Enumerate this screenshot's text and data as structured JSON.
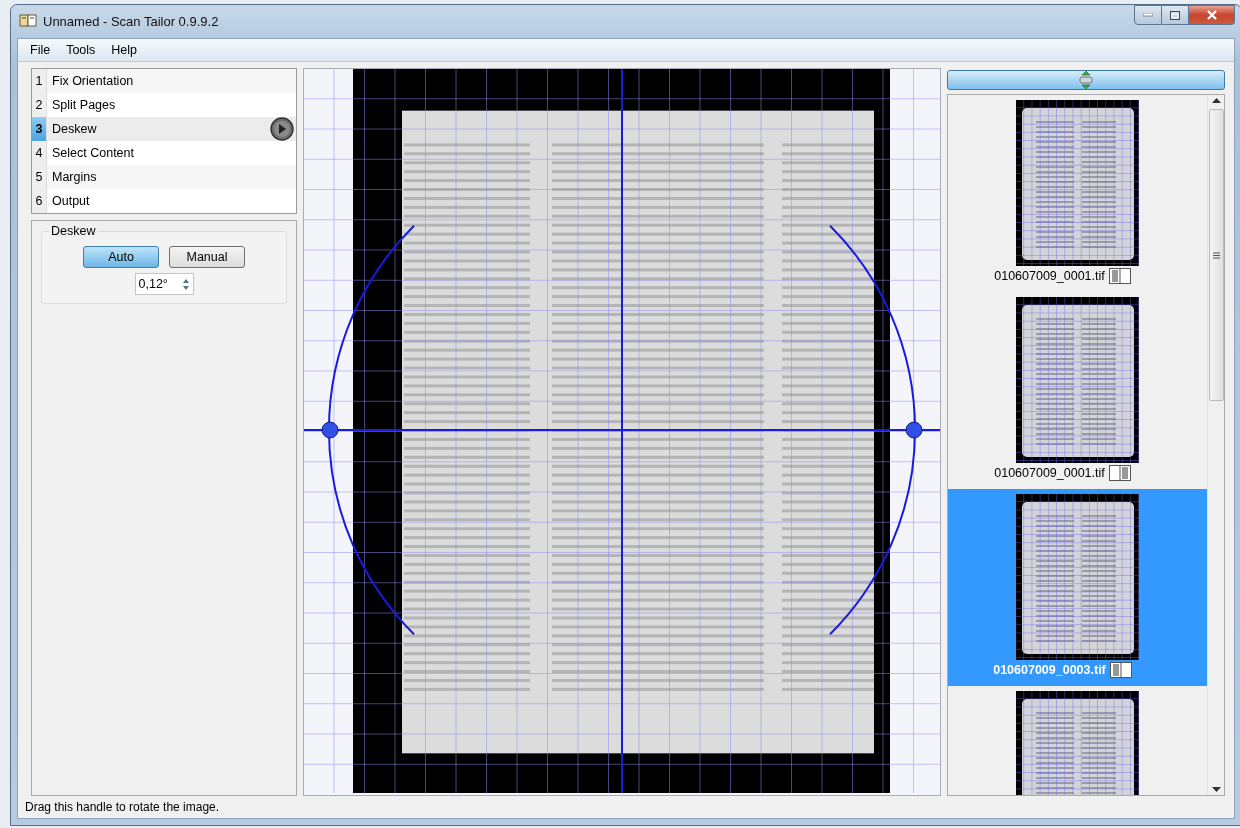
{
  "window": {
    "title": "Unnamed - Scan Tailor 0.9.9.2"
  },
  "menu": [
    {
      "label": "File"
    },
    {
      "label": "Tools"
    },
    {
      "label": "Help"
    }
  ],
  "stages": [
    {
      "number": "1",
      "label": "Fix Orientation",
      "selected": false
    },
    {
      "number": "2",
      "label": "Split Pages",
      "selected": false
    },
    {
      "number": "3",
      "label": "Deskew",
      "selected": true
    },
    {
      "number": "4",
      "label": "Select Content",
      "selected": false
    },
    {
      "number": "5",
      "label": "Margins",
      "selected": false
    },
    {
      "number": "6",
      "label": "Output",
      "selected": false
    }
  ],
  "deskew": {
    "title": "Deskew",
    "modes": [
      {
        "label": "Auto",
        "selected": true
      },
      {
        "label": "Manual",
        "selected": false
      }
    ],
    "angle": "0,12°"
  },
  "thumbnails": [
    {
      "filename": "010607009_0001.tif",
      "selected": false,
      "left_page": true
    },
    {
      "filename": "010607009_0001.tif",
      "selected": false,
      "left_page": false
    },
    {
      "filename": "010607009_0003.tif",
      "selected": true,
      "left_page": true
    },
    {
      "selected": false
    }
  ],
  "status_bar": "Drag this handle to rotate the image."
}
